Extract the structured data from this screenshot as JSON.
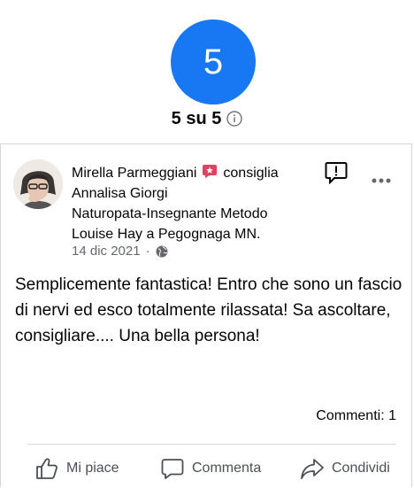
{
  "rating": {
    "score": "5",
    "summary": "5 su 5"
  },
  "review": {
    "author": "Mirella Parmeggiani",
    "verb": "consiglia",
    "page_name_line1": "Annalisa Giorgi",
    "page_name_line2": "Naturopata-Insegnante Metodo",
    "page_name_line3": "Louise Hay a Pegognaga MN.",
    "date": "14 dic 2021",
    "separator": "·",
    "text": "Semplicemente fantastica! Entro che sono un fascio di nervi ed esco totalmente rilassata! Sa ascoltare, consigliare.... Una bella persona!",
    "comments": "Commenti: 1"
  },
  "actions": {
    "like": "Mi piace",
    "comment": "Commenta",
    "share": "Condividi"
  },
  "colors": {
    "accent": "#1877f2",
    "recommend_badge": "#e4405f",
    "meta_text": "#65676b"
  }
}
